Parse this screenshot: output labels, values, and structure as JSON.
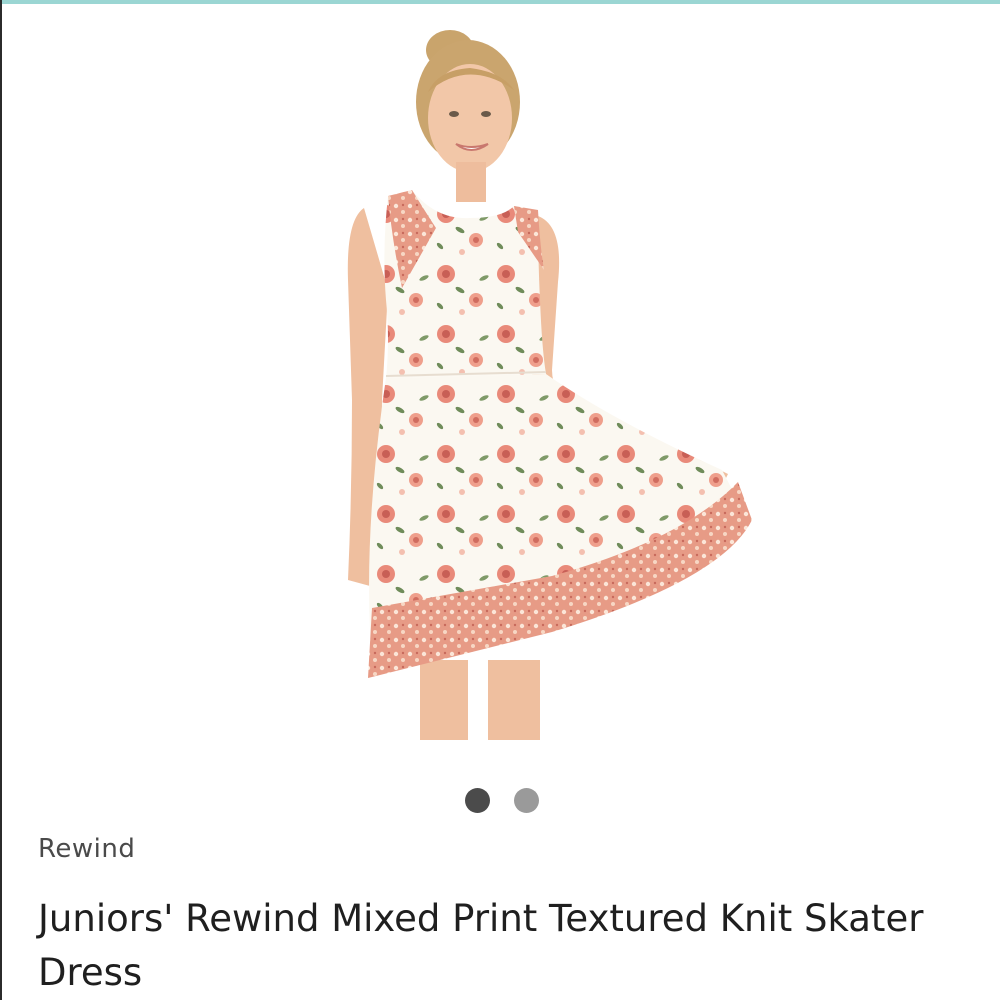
{
  "colors": {
    "top_accent": "#9bd6d3",
    "dot_active": "#4b4b4b",
    "dot_inactive": "#9a9a9a",
    "brand_text": "#4a4a4a",
    "title_text": "#1f1f1f"
  },
  "gallery": {
    "image_count": 2,
    "active_index": 1
  },
  "product": {
    "brand": "Rewind",
    "title": "Juniors' Rewind Mixed Print Textured Knit Skater Dress"
  }
}
